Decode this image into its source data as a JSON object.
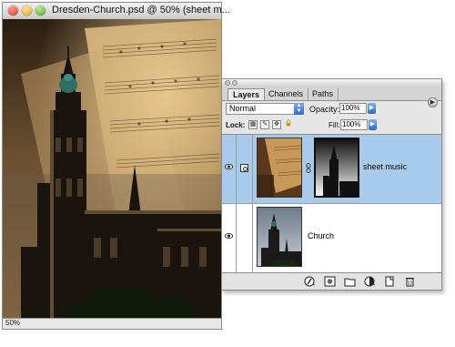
{
  "document": {
    "title": "Dresden-Church.psd @ 50% (sheet m...",
    "zoom": "50%"
  },
  "layers_panel": {
    "tabs": [
      "Layers",
      "Channels",
      "Paths"
    ],
    "active_tab": "Layers",
    "blend_mode": "Normal",
    "opacity_label": "Opacity:",
    "opacity_value": "100%",
    "lock_label": "Lock:",
    "fill_label": "Fill:",
    "fill_value": "100%",
    "layers": [
      {
        "name": "sheet music",
        "selected": true,
        "visible": true,
        "has_mask": true
      },
      {
        "name": "Church",
        "selected": false,
        "visible": true,
        "has_mask": false
      }
    ]
  },
  "colors": {
    "selection": "#a8cbec",
    "accent_blue": "#2f67c8"
  },
  "icons": {
    "bottom_bar": [
      "layer-style-icon",
      "add-mask-icon",
      "new-group-icon",
      "adjustment-layer-icon",
      "new-layer-icon",
      "trash-icon"
    ],
    "lock": [
      "lock-transparent-icon",
      "lock-image-icon",
      "lock-position-icon",
      "lock-all-icon"
    ]
  }
}
